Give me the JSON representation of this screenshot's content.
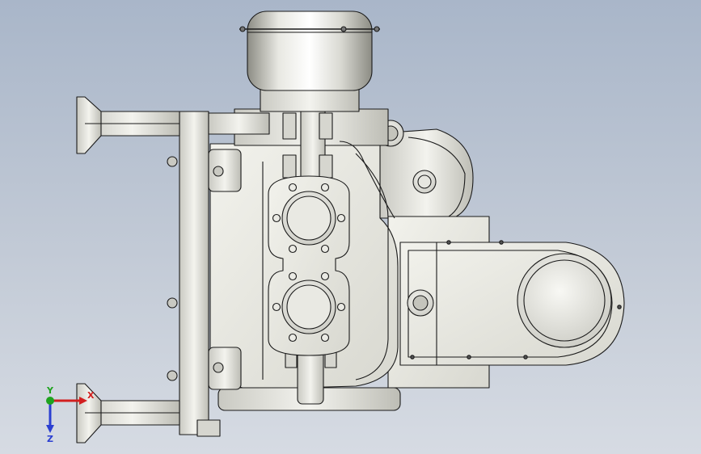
{
  "viewport": {
    "background_top": "#a9b6c9",
    "background_bottom": "#d6dbe3"
  },
  "model": {
    "part_color_light": "#f0f0ea",
    "part_color_mid": "#d6d6cf",
    "part_color_dark": "#8f8f88",
    "edge_color": "#1a1a1a"
  },
  "triad": {
    "x_label": "X",
    "y_label": "Y",
    "z_label": "Z",
    "x_color": "#d21f1f",
    "y_color": "#1fa31f",
    "z_color": "#2b3fd1"
  }
}
